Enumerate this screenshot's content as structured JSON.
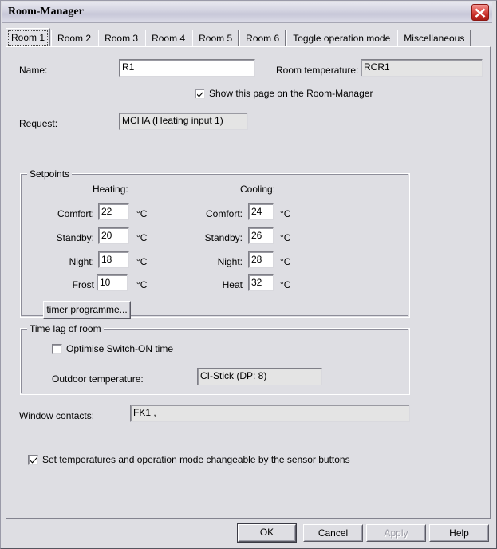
{
  "window": {
    "title": "Room-Manager",
    "close_icon": "close-x-icon"
  },
  "tabs": [
    {
      "label": "Room 1",
      "active": true
    },
    {
      "label": "Room 2",
      "active": false
    },
    {
      "label": "Room 3",
      "active": false
    },
    {
      "label": "Room 4",
      "active": false
    },
    {
      "label": "Room 5",
      "active": false
    },
    {
      "label": "Room 6",
      "active": false
    },
    {
      "label": "Toggle operation mode",
      "active": false
    },
    {
      "label": "Miscellaneous",
      "active": false
    }
  ],
  "form": {
    "name_label": "Name:",
    "name_value": "R1",
    "room_temperature_label": "Room temperature:",
    "room_temperature_value": "RCR1",
    "show_page_checkbox_label": "Show this page on the Room-Manager",
    "show_page_checked": true,
    "request_label": "Request:",
    "request_value": "MCHA  (Heating input 1)"
  },
  "setpoints": {
    "title": "Setpoints",
    "heating_header": "Heating:",
    "cooling_header": "Cooling:",
    "unit": "°C",
    "heating": [
      {
        "label": "Comfort:",
        "value": "22"
      },
      {
        "label": "Standby:",
        "value": "20"
      },
      {
        "label": "Night:",
        "value": "18"
      },
      {
        "label": "Frost",
        "value": "10"
      }
    ],
    "cooling": [
      {
        "label": "Comfort:",
        "value": "24"
      },
      {
        "label": "Standby:",
        "value": "26"
      },
      {
        "label": "Night:",
        "value": "28"
      },
      {
        "label": "Heat",
        "value": "32"
      }
    ],
    "timer_button": "timer programme..."
  },
  "time_lag": {
    "title": "Time lag of room",
    "optimise_label": "Optimise Switch-ON time",
    "optimise_checked": false,
    "outdoor_label": "Outdoor temperature:",
    "outdoor_value": "CI-Stick  (DP: 8)"
  },
  "window_contacts": {
    "label": "Window contacts:",
    "value": "FK1 ,"
  },
  "sensor_buttons": {
    "label": "Set temperatures and operation mode changeable by the sensor buttons",
    "checked": true
  },
  "footer": {
    "ok": "OK",
    "cancel": "Cancel",
    "apply": "Apply",
    "help": "Help",
    "apply_disabled": true
  }
}
